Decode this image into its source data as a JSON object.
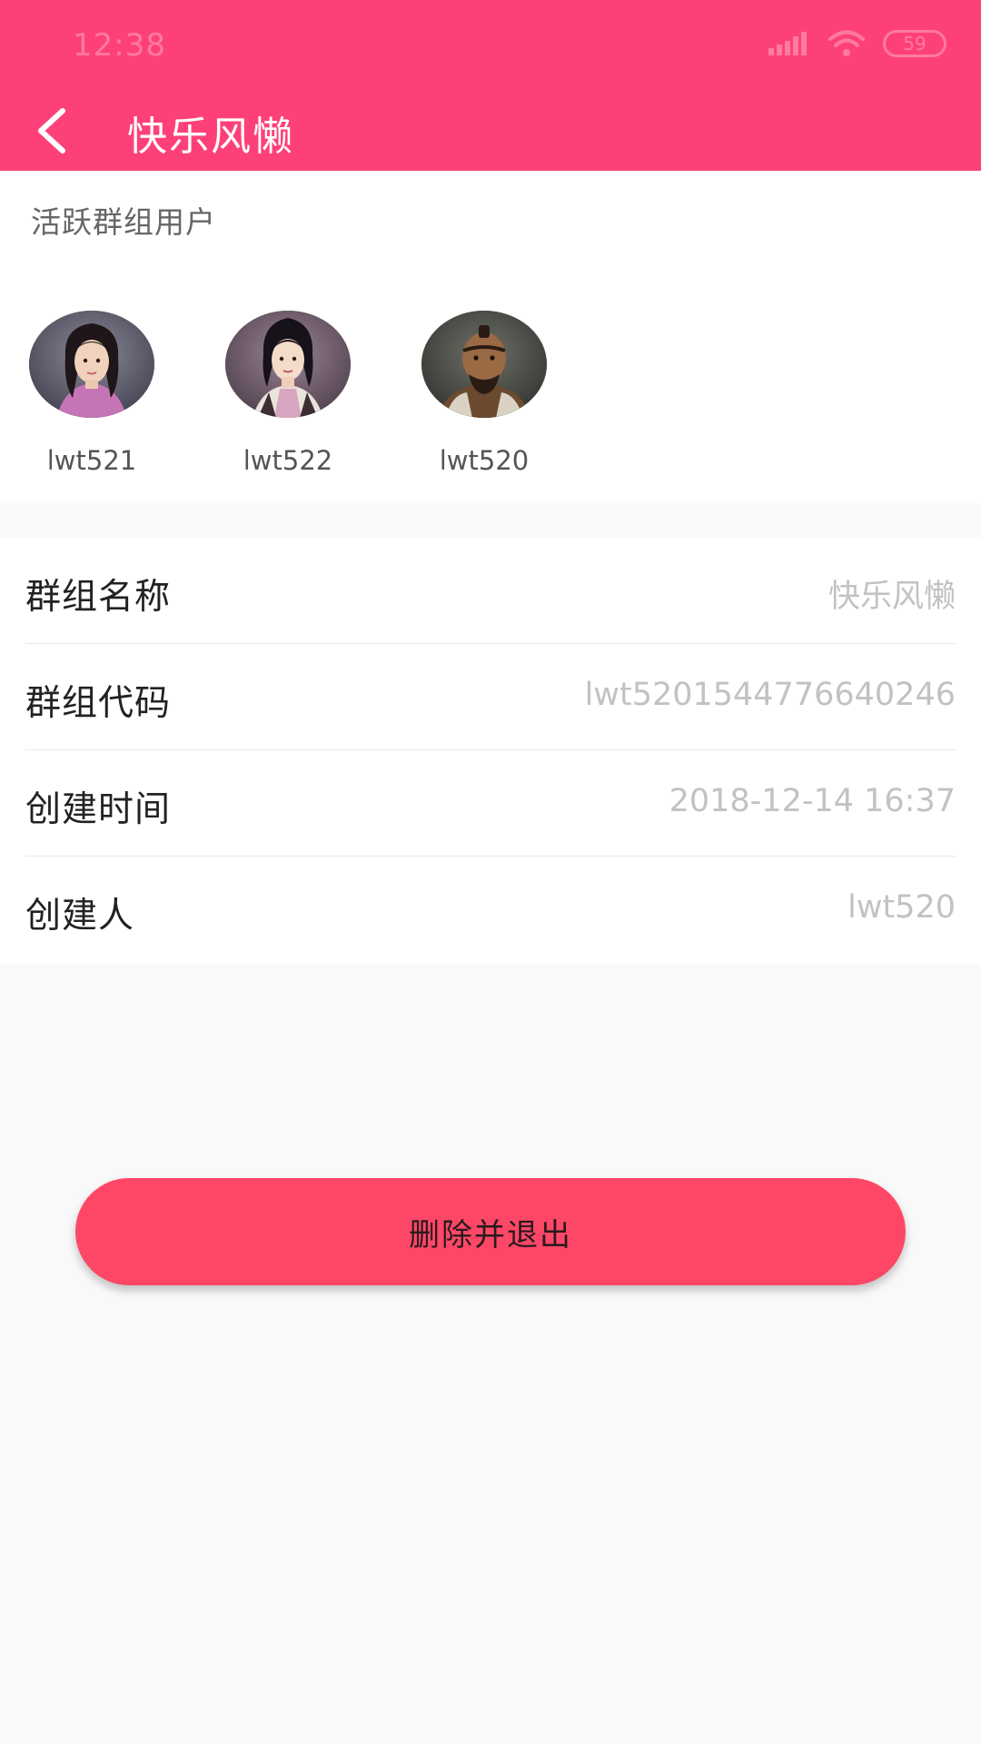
{
  "status_bar": {
    "time": "12:38",
    "battery": "59"
  },
  "header": {
    "title": "快乐风懒"
  },
  "members": {
    "heading": "活跃群组用户",
    "items": [
      {
        "name": "lwt521"
      },
      {
        "name": "lwt522"
      },
      {
        "name": "lwt520"
      }
    ]
  },
  "info": {
    "rows": [
      {
        "label": "群组名称",
        "value": "快乐风懒"
      },
      {
        "label": "群组代码",
        "value": "lwt5201544776640246"
      },
      {
        "label": "创建时间",
        "value": "2018-12-14 16:37"
      },
      {
        "label": "创建人",
        "value": "lwt520"
      }
    ]
  },
  "actions": {
    "delete_label": "删除并退出"
  },
  "colors": {
    "header_bg": "#fd4178",
    "button_bg": "#fe4766",
    "page_bg": "#f9f9f9"
  }
}
